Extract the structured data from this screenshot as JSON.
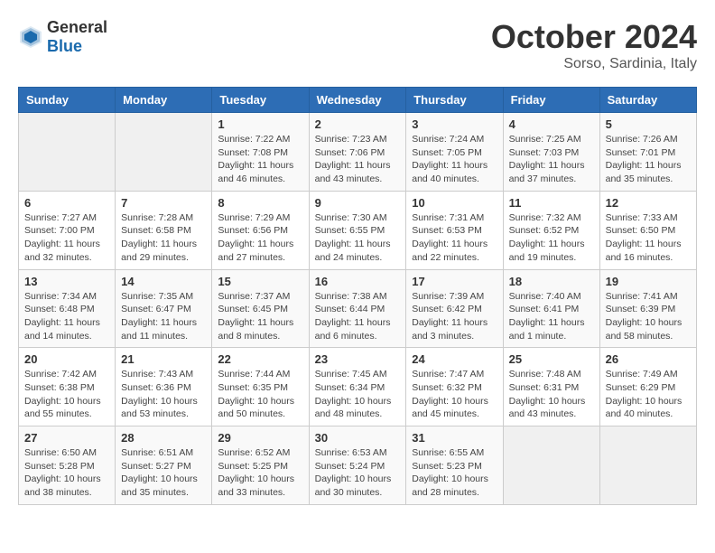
{
  "logo": {
    "general": "General",
    "blue": "Blue"
  },
  "header": {
    "month": "October 2024",
    "location": "Sorso, Sardinia, Italy"
  },
  "weekdays": [
    "Sunday",
    "Monday",
    "Tuesday",
    "Wednesday",
    "Thursday",
    "Friday",
    "Saturday"
  ],
  "weeks": [
    [
      {
        "day": "",
        "info": ""
      },
      {
        "day": "",
        "info": ""
      },
      {
        "day": "1",
        "info": "Sunrise: 7:22 AM\nSunset: 7:08 PM\nDaylight: 11 hours and 46 minutes."
      },
      {
        "day": "2",
        "info": "Sunrise: 7:23 AM\nSunset: 7:06 PM\nDaylight: 11 hours and 43 minutes."
      },
      {
        "day": "3",
        "info": "Sunrise: 7:24 AM\nSunset: 7:05 PM\nDaylight: 11 hours and 40 minutes."
      },
      {
        "day": "4",
        "info": "Sunrise: 7:25 AM\nSunset: 7:03 PM\nDaylight: 11 hours and 37 minutes."
      },
      {
        "day": "5",
        "info": "Sunrise: 7:26 AM\nSunset: 7:01 PM\nDaylight: 11 hours and 35 minutes."
      }
    ],
    [
      {
        "day": "6",
        "info": "Sunrise: 7:27 AM\nSunset: 7:00 PM\nDaylight: 11 hours and 32 minutes."
      },
      {
        "day": "7",
        "info": "Sunrise: 7:28 AM\nSunset: 6:58 PM\nDaylight: 11 hours and 29 minutes."
      },
      {
        "day": "8",
        "info": "Sunrise: 7:29 AM\nSunset: 6:56 PM\nDaylight: 11 hours and 27 minutes."
      },
      {
        "day": "9",
        "info": "Sunrise: 7:30 AM\nSunset: 6:55 PM\nDaylight: 11 hours and 24 minutes."
      },
      {
        "day": "10",
        "info": "Sunrise: 7:31 AM\nSunset: 6:53 PM\nDaylight: 11 hours and 22 minutes."
      },
      {
        "day": "11",
        "info": "Sunrise: 7:32 AM\nSunset: 6:52 PM\nDaylight: 11 hours and 19 minutes."
      },
      {
        "day": "12",
        "info": "Sunrise: 7:33 AM\nSunset: 6:50 PM\nDaylight: 11 hours and 16 minutes."
      }
    ],
    [
      {
        "day": "13",
        "info": "Sunrise: 7:34 AM\nSunset: 6:48 PM\nDaylight: 11 hours and 14 minutes."
      },
      {
        "day": "14",
        "info": "Sunrise: 7:35 AM\nSunset: 6:47 PM\nDaylight: 11 hours and 11 minutes."
      },
      {
        "day": "15",
        "info": "Sunrise: 7:37 AM\nSunset: 6:45 PM\nDaylight: 11 hours and 8 minutes."
      },
      {
        "day": "16",
        "info": "Sunrise: 7:38 AM\nSunset: 6:44 PM\nDaylight: 11 hours and 6 minutes."
      },
      {
        "day": "17",
        "info": "Sunrise: 7:39 AM\nSunset: 6:42 PM\nDaylight: 11 hours and 3 minutes."
      },
      {
        "day": "18",
        "info": "Sunrise: 7:40 AM\nSunset: 6:41 PM\nDaylight: 11 hours and 1 minute."
      },
      {
        "day": "19",
        "info": "Sunrise: 7:41 AM\nSunset: 6:39 PM\nDaylight: 10 hours and 58 minutes."
      }
    ],
    [
      {
        "day": "20",
        "info": "Sunrise: 7:42 AM\nSunset: 6:38 PM\nDaylight: 10 hours and 55 minutes."
      },
      {
        "day": "21",
        "info": "Sunrise: 7:43 AM\nSunset: 6:36 PM\nDaylight: 10 hours and 53 minutes."
      },
      {
        "day": "22",
        "info": "Sunrise: 7:44 AM\nSunset: 6:35 PM\nDaylight: 10 hours and 50 minutes."
      },
      {
        "day": "23",
        "info": "Sunrise: 7:45 AM\nSunset: 6:34 PM\nDaylight: 10 hours and 48 minutes."
      },
      {
        "day": "24",
        "info": "Sunrise: 7:47 AM\nSunset: 6:32 PM\nDaylight: 10 hours and 45 minutes."
      },
      {
        "day": "25",
        "info": "Sunrise: 7:48 AM\nSunset: 6:31 PM\nDaylight: 10 hours and 43 minutes."
      },
      {
        "day": "26",
        "info": "Sunrise: 7:49 AM\nSunset: 6:29 PM\nDaylight: 10 hours and 40 minutes."
      }
    ],
    [
      {
        "day": "27",
        "info": "Sunrise: 6:50 AM\nSunset: 5:28 PM\nDaylight: 10 hours and 38 minutes."
      },
      {
        "day": "28",
        "info": "Sunrise: 6:51 AM\nSunset: 5:27 PM\nDaylight: 10 hours and 35 minutes."
      },
      {
        "day": "29",
        "info": "Sunrise: 6:52 AM\nSunset: 5:25 PM\nDaylight: 10 hours and 33 minutes."
      },
      {
        "day": "30",
        "info": "Sunrise: 6:53 AM\nSunset: 5:24 PM\nDaylight: 10 hours and 30 minutes."
      },
      {
        "day": "31",
        "info": "Sunrise: 6:55 AM\nSunset: 5:23 PM\nDaylight: 10 hours and 28 minutes."
      },
      {
        "day": "",
        "info": ""
      },
      {
        "day": "",
        "info": ""
      }
    ]
  ]
}
